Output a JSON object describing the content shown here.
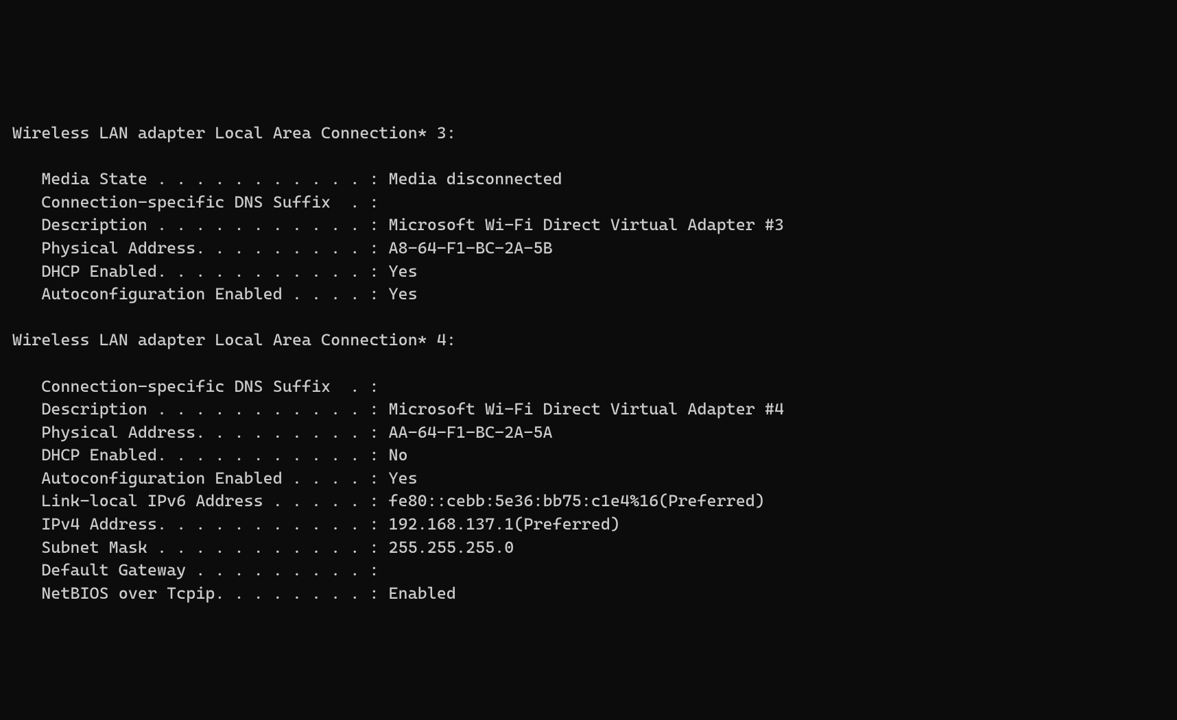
{
  "adapters": [
    {
      "name": "Wireless LAN adapter Local Area Connection* 3:",
      "properties": [
        {
          "label": "   Media State . . . . . . . . . . . : ",
          "value": "Media disconnected"
        },
        {
          "label": "   Connection-specific DNS Suffix  . : ",
          "value": ""
        },
        {
          "label": "   Description . . . . . . . . . . . : ",
          "value": "Microsoft Wi-Fi Direct Virtual Adapter #3"
        },
        {
          "label": "   Physical Address. . . . . . . . . : ",
          "value": "A8-64-F1-BC-2A-5B"
        },
        {
          "label": "   DHCP Enabled. . . . . . . . . . . : ",
          "value": "Yes"
        },
        {
          "label": "   Autoconfiguration Enabled . . . . : ",
          "value": "Yes"
        }
      ]
    },
    {
      "name": "Wireless LAN adapter Local Area Connection* 4:",
      "properties": [
        {
          "label": "   Connection-specific DNS Suffix  . : ",
          "value": ""
        },
        {
          "label": "   Description . . . . . . . . . . . : ",
          "value": "Microsoft Wi-Fi Direct Virtual Adapter #4"
        },
        {
          "label": "   Physical Address. . . . . . . . . : ",
          "value": "AA-64-F1-BC-2A-5A"
        },
        {
          "label": "   DHCP Enabled. . . . . . . . . . . : ",
          "value": "No"
        },
        {
          "label": "   Autoconfiguration Enabled . . . . : ",
          "value": "Yes"
        },
        {
          "label": "   Link-local IPv6 Address . . . . . : ",
          "value": "fe80::cebb:5e36:bb75:c1e4%16(Preferred)"
        },
        {
          "label": "   IPv4 Address. . . . . . . . . . . : ",
          "value": "192.168.137.1(Preferred)"
        },
        {
          "label": "   Subnet Mask . . . . . . . . . . . : ",
          "value": "255.255.255.0"
        },
        {
          "label": "   Default Gateway . . . . . . . . . : ",
          "value": ""
        },
        {
          "label": "   NetBIOS over Tcpip. . . . . . . . : ",
          "value": "Enabled"
        }
      ]
    }
  ]
}
